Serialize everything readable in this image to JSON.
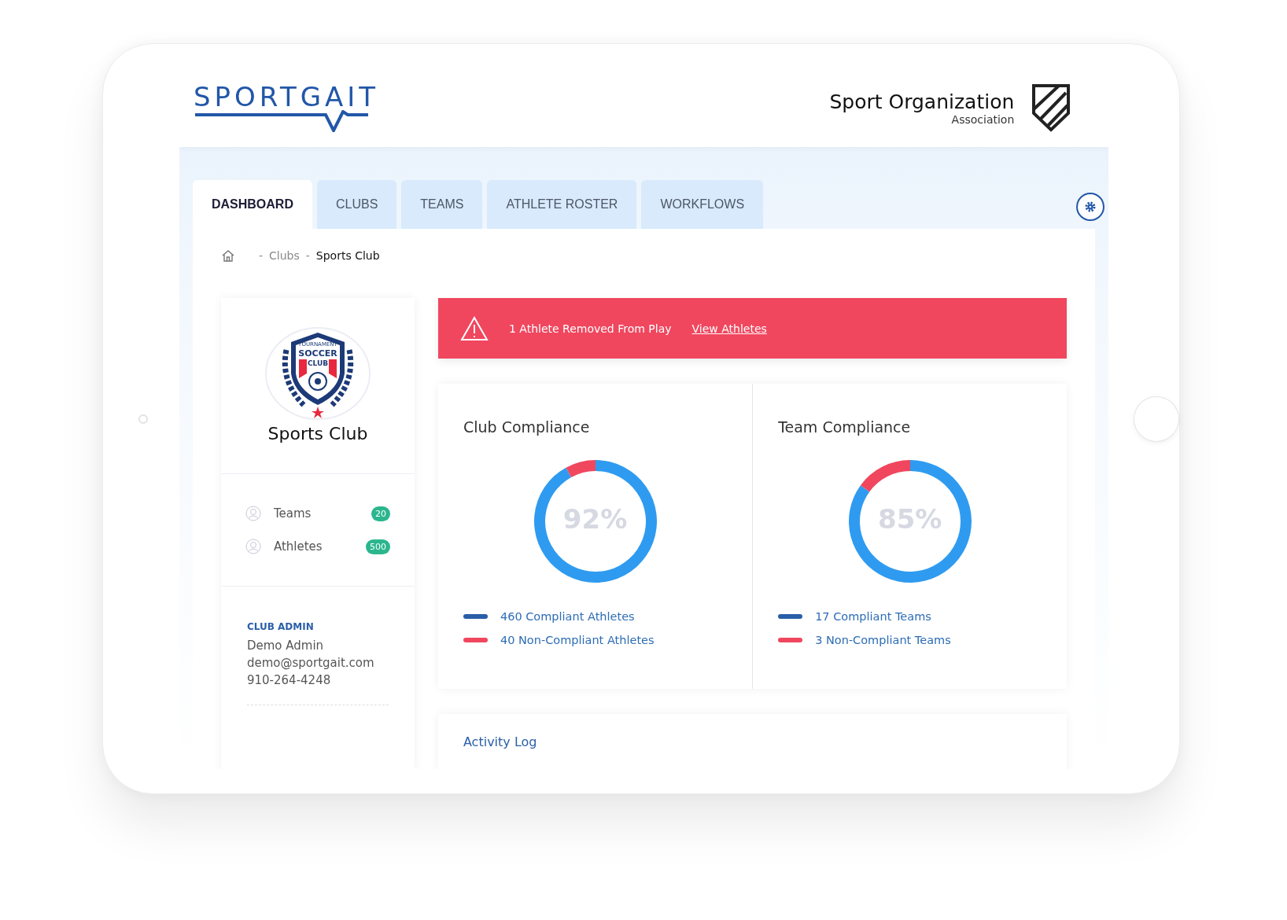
{
  "header": {
    "logo": "SPORTGAIT",
    "organization": "Sport Organization",
    "organization_subtitle": "Association"
  },
  "tabs": [
    {
      "label": "DASHBOARD",
      "selected": true
    },
    {
      "label": "CLUBS",
      "selected": false
    },
    {
      "label": "TEAMS",
      "selected": false
    },
    {
      "label": "ATHLETE ROSTER",
      "selected": false
    },
    {
      "label": "WORKFLOWS",
      "selected": false
    }
  ],
  "breadcrumb": [
    "-",
    "Clubs",
    "-",
    "Sports Club"
  ],
  "club": {
    "crest": {
      "top": "TOURNAMENT",
      "line1": "SOCCER",
      "line2": "CLUB"
    },
    "name": "Sports Club",
    "stats": [
      {
        "label": "Teams",
        "count": "20"
      },
      {
        "label": "Athletes",
        "count": "500"
      }
    ],
    "admin": {
      "heading": "CLUB ADMIN",
      "name": "Demo Admin",
      "email": "demo@sportgait.com",
      "phone": "910-264-4248"
    }
  },
  "alert": {
    "message": "1 Athlete Removed From Play",
    "link": "View Athletes"
  },
  "compliance": [
    {
      "title": "Club Compliance",
      "center_label": "92%",
      "chart_data": {
        "type": "donut",
        "categories": [
          "460 Compliant Athletes",
          "40 Non-Compliant Athletes"
        ],
        "values": [
          460,
          40
        ]
      },
      "legend": [
        {
          "color": "#2a5fa8"
        },
        {
          "color": "#f0475f"
        }
      ]
    },
    {
      "title": "Team Compliance",
      "center_label": "85%",
      "chart_data": {
        "type": "donut",
        "categories": [
          "17 Compliant Teams",
          "3 Non-Compliant Teams"
        ],
        "values": [
          17,
          3
        ]
      },
      "legend": [
        {
          "color": "#2a5fa8"
        },
        {
          "color": "#f0475f"
        }
      ]
    }
  ],
  "activity_log": {
    "title": "Activity Log"
  }
}
